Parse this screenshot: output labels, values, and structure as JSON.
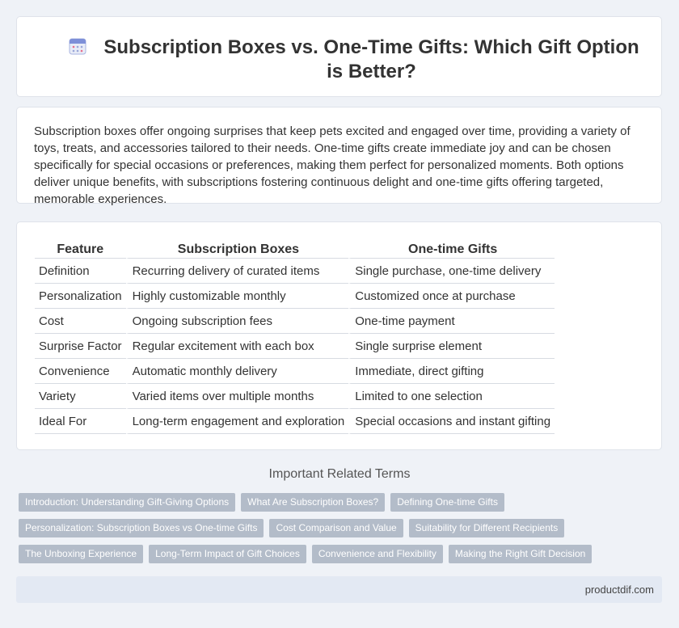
{
  "header": {
    "title": "Subscription Boxes vs. One-Time Gifts: Which Gift Option is Better?",
    "icon": "calendar-icon"
  },
  "intro": {
    "text": "Subscription boxes offer ongoing surprises that keep pets excited and engaged over time, providing a variety of toys, treats, and accessories tailored to their needs. One-time gifts create immediate joy and can be chosen specifically for special occasions or preferences, making them perfect for personalized moments. Both options deliver unique benefits, with subscriptions fostering continuous delight and one-time gifts offering targeted, memorable experiences."
  },
  "table": {
    "headers": [
      "Feature",
      "Subscription Boxes",
      "One-time Gifts"
    ],
    "rows": [
      [
        "Definition",
        "Recurring delivery of curated items",
        "Single purchase, one-time delivery"
      ],
      [
        "Personalization",
        "Highly customizable monthly",
        "Customized once at purchase"
      ],
      [
        "Cost",
        "Ongoing subscription fees",
        "One-time payment"
      ],
      [
        "Surprise Factor",
        "Regular excitement with each box",
        "Single surprise element"
      ],
      [
        "Convenience",
        "Automatic monthly delivery",
        "Immediate, direct gifting"
      ],
      [
        "Variety",
        "Varied items over multiple months",
        "Limited to one selection"
      ],
      [
        "Ideal For",
        "Long-term engagement and exploration",
        "Special occasions and instant gifting"
      ]
    ]
  },
  "related": {
    "title": "Important Related Terms",
    "tags": [
      [
        "Introduction: Understanding Gift-Giving Options",
        "What Are Subscription Boxes?",
        "Defining One-time Gifts"
      ],
      [
        "Personalization: Subscription Boxes vs One-time Gifts",
        "Cost Comparison and Value",
        "Suitability for Different Recipients"
      ],
      [
        "The Unboxing Experience",
        "Long-Term Impact of Gift Choices",
        "Convenience and Flexibility",
        "Making the Right Gift Decision"
      ]
    ]
  },
  "footer": {
    "site": "productdif.com"
  },
  "colors": {
    "background": "#eff2f7",
    "tag": "#b3bcc9",
    "footer": "#e3e9f3"
  }
}
